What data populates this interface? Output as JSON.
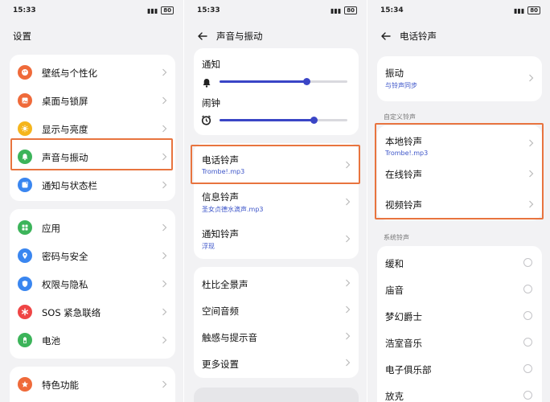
{
  "status": {
    "time1": "15:33",
    "time2": "15:33",
    "time3": "15:34",
    "battery": "80"
  },
  "screen1": {
    "title": "设置",
    "group1": [
      {
        "label": "壁纸与个性化",
        "icon": "palette-icon",
        "color": "#ef6a3a"
      },
      {
        "label": "桌面与锁屏",
        "icon": "picture-icon",
        "color": "#ef6a3a"
      },
      {
        "label": "显示与亮度",
        "icon": "brightness-icon",
        "color": "#f5b51c"
      },
      {
        "label": "声音与振动",
        "icon": "bell-icon",
        "color": "#3cb45a"
      },
      {
        "label": "通知与状态栏",
        "icon": "notification-icon",
        "color": "#3a86f0"
      }
    ],
    "group2": [
      {
        "label": "应用",
        "icon": "apps-icon",
        "color": "#3cb45a"
      },
      {
        "label": "密码与安全",
        "icon": "location-icon",
        "color": "#3a86f0"
      },
      {
        "label": "权限与隐私",
        "icon": "shield-icon",
        "color": "#3a86f0"
      },
      {
        "label": "SOS 紧急联络",
        "icon": "sos-icon",
        "color": "#ef4545"
      },
      {
        "label": "电池",
        "icon": "battery-icon",
        "color": "#3cb45a"
      }
    ],
    "group3": [
      {
        "label": "特色功能",
        "icon": "star-icon",
        "color": "#ef6a3a"
      }
    ]
  },
  "screen2": {
    "title": "声音与振动",
    "notify_label": "通知",
    "notify_level": 0.68,
    "alarm_label": "闹钟",
    "alarm_level": 0.74,
    "ringtones": [
      {
        "label": "电话铃声",
        "value": "Trombe!.mp3"
      },
      {
        "label": "信息铃声",
        "value": "圣女贞德水滴声.mp3"
      },
      {
        "label": "通知铃声",
        "value": "浮现"
      }
    ],
    "more": [
      "杜比全景声",
      "空间音频",
      "触感与提示音",
      "更多设置"
    ]
  },
  "screen3": {
    "title": "电话铃声",
    "vibrate_label": "振动",
    "vibrate_sub": "与铃声同步",
    "custom_section": "自定义铃声",
    "custom": [
      {
        "label": "本地铃声",
        "value": "Trombe!.mp3"
      },
      {
        "label": "在线铃声",
        "value": ""
      },
      {
        "label": "视频铃声",
        "value": ""
      }
    ],
    "system_section": "系统铃声",
    "system": [
      "缓和",
      "庙音",
      "梦幻爵士",
      "浩室音乐",
      "电子俱乐部",
      "放克"
    ]
  },
  "colors": {
    "accent": "#3a45c6",
    "highlight": "#e8743f",
    "link": "#3d55c9"
  }
}
